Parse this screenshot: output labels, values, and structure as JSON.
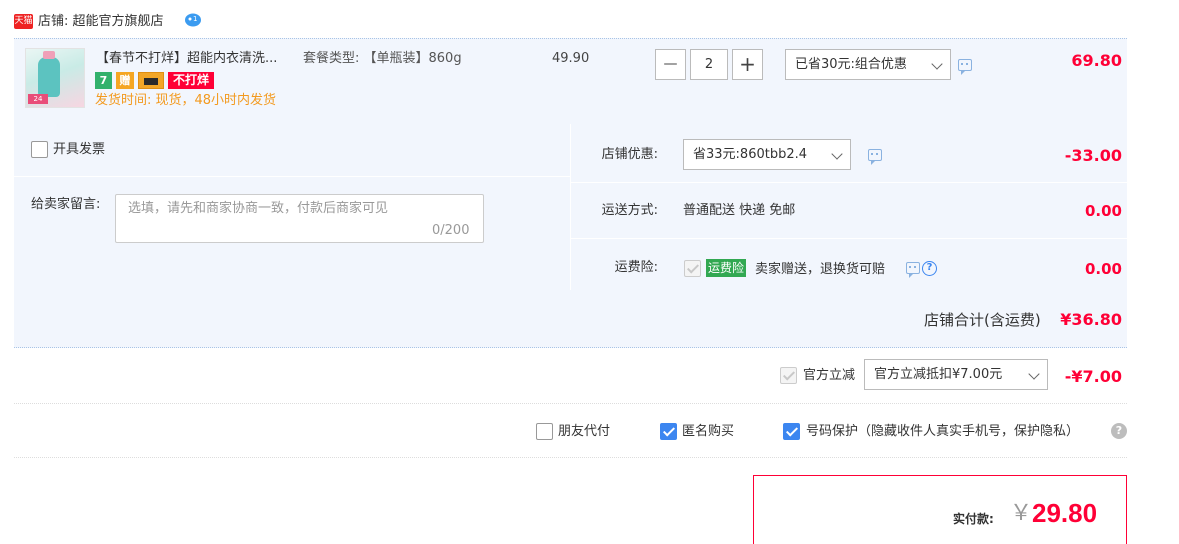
{
  "shop": {
    "badge": "天猫",
    "name": "店铺: 超能官方旗舰店",
    "chat_badge": "1"
  },
  "item": {
    "thumb_tag": "24",
    "title": "【春节不打烊】超能内衣清洗...",
    "package": "套餐类型: 【单瓶装】860g",
    "unit_price": "49.90",
    "quantity": "2",
    "minus_label": "—",
    "plus_label": "+",
    "promotion": "已省30元:组合优惠",
    "total": "69.80",
    "badges": [
      "7",
      "赠",
      "",
      "不打烊"
    ],
    "ship_time": "发货时间: 现货，48小时内发货"
  },
  "invoice": {
    "label": "开具发票",
    "checked": false
  },
  "message": {
    "label": "给卖家留言:",
    "placeholder": "选填，请先和商家协商一致，付款后商家可见",
    "count": "0/200"
  },
  "shop_coupon": {
    "label": "店铺优惠:",
    "value": "省33元:860tbb2.4",
    "amount": "-33.00"
  },
  "shipping": {
    "label": "运送方式:",
    "value": "普通配送 快递 免邮",
    "amount": "0.00"
  },
  "insurance": {
    "label": "运费险:",
    "tag": "运费险",
    "text": "卖家赠送，退换货可赔",
    "amount": "0.00",
    "help": "?"
  },
  "subtotal": {
    "label": "店铺合计(含运费)",
    "value": "¥36.80"
  },
  "official": {
    "label": "官方立减",
    "select": "官方立减抵扣¥7.00元",
    "amount": "-¥7.00"
  },
  "options": {
    "friend_pay": {
      "label": "朋友代付",
      "checked": false
    },
    "anonymous": {
      "label": "匿名购买",
      "checked": true
    },
    "number_protect": {
      "label": "号码保护（隐藏收件人真实手机号，保护隐私）",
      "checked": true
    },
    "help": "?"
  },
  "payment": {
    "label": "实付款:",
    "currency": "￥",
    "amount": "29.80"
  },
  "colors": {
    "accent_red": "#ff0036",
    "bg_blue": "#f2f6fd",
    "checkbox_blue": "#3c86f0",
    "ship_orange": "#f39a1f"
  }
}
